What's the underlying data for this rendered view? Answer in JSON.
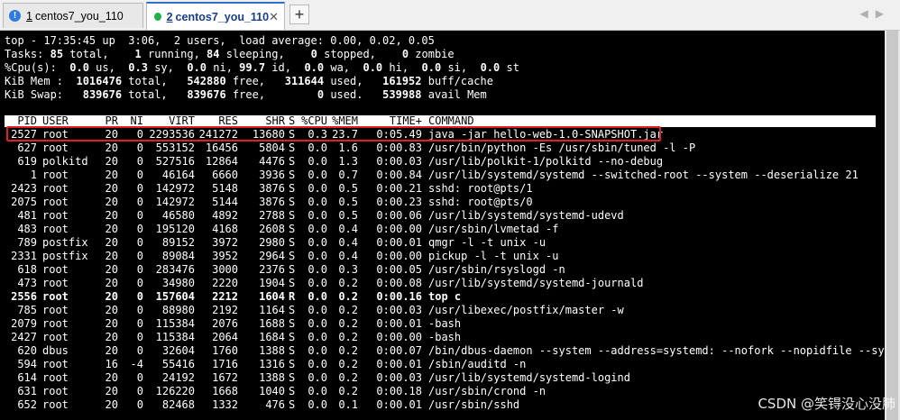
{
  "tabs": [
    {
      "num": "1",
      "label": "centos7_you_110",
      "status": "warning",
      "active": false
    },
    {
      "num": "2",
      "label": "centos7_you_110",
      "status": "connected",
      "active": true
    }
  ],
  "tab_add_label": "+",
  "summary": {
    "line1": "top - 17:35:45 up  3:06,  2 users,  load average: 0.00, 0.02, 0.05",
    "tasks": {
      "label": "Tasks:",
      "total": "85",
      "running": "1",
      "sleeping": "84",
      "stopped": "0",
      "zombie": "0"
    },
    "cpu": {
      "label": "%Cpu(s):",
      "us": "0.0",
      "sy": "0.3",
      "ni": "0.0",
      "id": "99.7",
      "wa": "0.0",
      "hi": "0.0",
      "si": "0.0",
      "st": "0.0"
    },
    "mem": {
      "label": "KiB Mem :",
      "total": "1016476",
      "free": "542880",
      "used": "311644",
      "buff": "161952"
    },
    "swap": {
      "label": "KiB Swap:",
      "total": "839676",
      "free": "839676",
      "used": "0",
      "avail": "539988"
    }
  },
  "header": {
    "pid": "PID",
    "user": "USER",
    "pr": "PR",
    "ni": "NI",
    "virt": "VIRT",
    "res": "RES",
    "shr": "SHR",
    "s": "S",
    "cpu": "%CPU",
    "mem": "%MEM",
    "time": "TIME+",
    "cmd": "COMMAND"
  },
  "processes": [
    {
      "pid": "2527",
      "user": "root",
      "pr": "20",
      "ni": "0",
      "virt": "2293536",
      "res": "241272",
      "shr": "13680",
      "s": "S",
      "cpu": "0.3",
      "mem": "23.7",
      "time": "0:05.49",
      "cmd": "java -jar hello-web-1.0-SNAPSHOT.jar"
    },
    {
      "pid": "627",
      "user": "root",
      "pr": "20",
      "ni": "0",
      "virt": "553152",
      "res": "16456",
      "shr": "5804",
      "s": "S",
      "cpu": "0.0",
      "mem": "1.6",
      "time": "0:00.83",
      "cmd": "/usr/bin/python -Es /usr/sbin/tuned -l -P"
    },
    {
      "pid": "619",
      "user": "polkitd",
      "pr": "20",
      "ni": "0",
      "virt": "527516",
      "res": "12864",
      "shr": "4476",
      "s": "S",
      "cpu": "0.0",
      "mem": "1.3",
      "time": "0:00.03",
      "cmd": "/usr/lib/polkit-1/polkitd --no-debug"
    },
    {
      "pid": "1",
      "user": "root",
      "pr": "20",
      "ni": "0",
      "virt": "46164",
      "res": "6660",
      "shr": "3936",
      "s": "S",
      "cpu": "0.0",
      "mem": "0.7",
      "time": "0:00.84",
      "cmd": "/usr/lib/systemd/systemd --switched-root --system --deserialize 21"
    },
    {
      "pid": "2423",
      "user": "root",
      "pr": "20",
      "ni": "0",
      "virt": "142972",
      "res": "5148",
      "shr": "3876",
      "s": "S",
      "cpu": "0.0",
      "mem": "0.5",
      "time": "0:00.21",
      "cmd": "sshd: root@pts/1"
    },
    {
      "pid": "2075",
      "user": "root",
      "pr": "20",
      "ni": "0",
      "virt": "142972",
      "res": "5144",
      "shr": "3876",
      "s": "S",
      "cpu": "0.0",
      "mem": "0.5",
      "time": "0:00.23",
      "cmd": "sshd: root@pts/0"
    },
    {
      "pid": "481",
      "user": "root",
      "pr": "20",
      "ni": "0",
      "virt": "46580",
      "res": "4892",
      "shr": "2788",
      "s": "S",
      "cpu": "0.0",
      "mem": "0.5",
      "time": "0:00.06",
      "cmd": "/usr/lib/systemd/systemd-udevd"
    },
    {
      "pid": "483",
      "user": "root",
      "pr": "20",
      "ni": "0",
      "virt": "195120",
      "res": "4168",
      "shr": "2608",
      "s": "S",
      "cpu": "0.0",
      "mem": "0.4",
      "time": "0:00.00",
      "cmd": "/usr/sbin/lvmetad -f"
    },
    {
      "pid": "789",
      "user": "postfix",
      "pr": "20",
      "ni": "0",
      "virt": "89152",
      "res": "3972",
      "shr": "2980",
      "s": "S",
      "cpu": "0.0",
      "mem": "0.4",
      "time": "0:00.01",
      "cmd": "qmgr -l -t unix -u"
    },
    {
      "pid": "2331",
      "user": "postfix",
      "pr": "20",
      "ni": "0",
      "virt": "89084",
      "res": "3952",
      "shr": "2964",
      "s": "S",
      "cpu": "0.0",
      "mem": "0.4",
      "time": "0:00.00",
      "cmd": "pickup -l -t unix -u"
    },
    {
      "pid": "618",
      "user": "root",
      "pr": "20",
      "ni": "0",
      "virt": "283476",
      "res": "3000",
      "shr": "2376",
      "s": "S",
      "cpu": "0.0",
      "mem": "0.3",
      "time": "0:00.05",
      "cmd": "/usr/sbin/rsyslogd -n"
    },
    {
      "pid": "473",
      "user": "root",
      "pr": "20",
      "ni": "0",
      "virt": "34980",
      "res": "2220",
      "shr": "1904",
      "s": "S",
      "cpu": "0.0",
      "mem": "0.2",
      "time": "0:00.08",
      "cmd": "/usr/lib/systemd/systemd-journald"
    },
    {
      "pid": "2556",
      "user": "root",
      "pr": "20",
      "ni": "0",
      "virt": "157604",
      "res": "2212",
      "shr": "1604",
      "s": "R",
      "cpu": "0.0",
      "mem": "0.2",
      "time": "0:00.16",
      "cmd": "top c",
      "bold": true
    },
    {
      "pid": "785",
      "user": "root",
      "pr": "20",
      "ni": "0",
      "virt": "88980",
      "res": "2192",
      "shr": "1164",
      "s": "S",
      "cpu": "0.0",
      "mem": "0.2",
      "time": "0:00.03",
      "cmd": "/usr/libexec/postfix/master -w"
    },
    {
      "pid": "2079",
      "user": "root",
      "pr": "20",
      "ni": "0",
      "virt": "115384",
      "res": "2076",
      "shr": "1688",
      "s": "S",
      "cpu": "0.0",
      "mem": "0.2",
      "time": "0:00.01",
      "cmd": "-bash"
    },
    {
      "pid": "2427",
      "user": "root",
      "pr": "20",
      "ni": "0",
      "virt": "115384",
      "res": "2064",
      "shr": "1684",
      "s": "S",
      "cpu": "0.0",
      "mem": "0.2",
      "time": "0:00.00",
      "cmd": "-bash"
    },
    {
      "pid": "620",
      "user": "dbus",
      "pr": "20",
      "ni": "0",
      "virt": "32604",
      "res": "1760",
      "shr": "1388",
      "s": "S",
      "cpu": "0.0",
      "mem": "0.2",
      "time": "0:00.07",
      "cmd": "/bin/dbus-daemon --system --address=systemd: --nofork --nopidfile --sy+"
    },
    {
      "pid": "594",
      "user": "root",
      "pr": "16",
      "ni": "-4",
      "virt": "55416",
      "res": "1716",
      "shr": "1316",
      "s": "S",
      "cpu": "0.0",
      "mem": "0.2",
      "time": "0:00.01",
      "cmd": "/sbin/auditd -n"
    },
    {
      "pid": "614",
      "user": "root",
      "pr": "20",
      "ni": "0",
      "virt": "24192",
      "res": "1672",
      "shr": "1388",
      "s": "S",
      "cpu": "0.0",
      "mem": "0.2",
      "time": "0:00.03",
      "cmd": "/usr/lib/systemd/systemd-logind"
    },
    {
      "pid": "631",
      "user": "root",
      "pr": "20",
      "ni": "0",
      "virt": "126220",
      "res": "1668",
      "shr": "1040",
      "s": "S",
      "cpu": "0.0",
      "mem": "0.2",
      "time": "0:00.18",
      "cmd": "/usr/sbin/crond -n"
    },
    {
      "pid": "652",
      "user": "root",
      "pr": "20",
      "ni": "0",
      "virt": "82468",
      "res": "1332",
      "shr": "476",
      "s": "S",
      "cpu": "0.0",
      "mem": "0.1",
      "time": "0:00.01",
      "cmd": "/usr/sbin/sshd"
    }
  ],
  "watermark": "CSDN @笑锝没心没肺"
}
